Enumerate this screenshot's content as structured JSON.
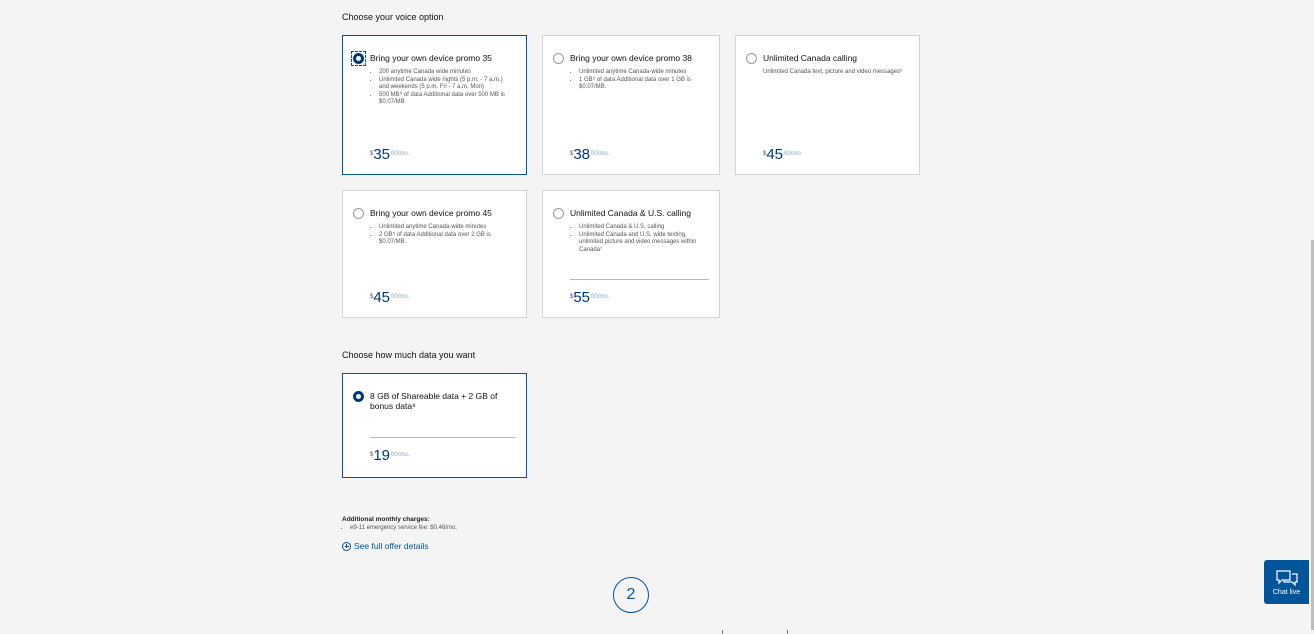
{
  "voice": {
    "title": "Choose your voice option",
    "options": [
      {
        "title": "Bring your own device promo 35",
        "features": [
          "200 anytime Canada wide minutes",
          "Unlimited Canada wide nights (5 p.m. - 7 a.m.) and weekends (5 p.m. Fri - 7 a.m. Mon)",
          "500 MB⁵ of data Additional data over 500 MB is $0.07/MB"
        ],
        "price": {
          "currency": "$",
          "dollars": "35",
          "cents": "00/mo."
        },
        "selected": true
      },
      {
        "title": "Bring your own device promo 38",
        "features": [
          "Unlimited anytime Canada-wide minutes",
          "1 GB⁵ of data Additional data over 1 GB is $0.07/MB."
        ],
        "price": {
          "currency": "$",
          "dollars": "38",
          "cents": "00/mo."
        },
        "selected": false
      },
      {
        "title": "Unlimited Canada calling",
        "description": "Unlimited Canada text, picture and video messages⁶",
        "price": {
          "currency": "$",
          "dollars": "45",
          "cents": "00/mo."
        },
        "selected": false
      },
      {
        "title": "Bring your own device promo 45",
        "features": [
          "Unlimited anytime Canada-wide minutes",
          "2 GB⁵ of data Additional data over 2 GB is $0.07/MB."
        ],
        "price": {
          "currency": "$",
          "dollars": "45",
          "cents": "00/mo."
        },
        "selected": false
      },
      {
        "title": "Unlimited Canada & U.S. calling",
        "features": [
          "Unlimited Canada & U.S. calling",
          "Unlimited Canada and U.S. wide texting, unlimited picture and video messages within Canada⁷"
        ],
        "price": {
          "currency": "$",
          "dollars": "55",
          "cents": "00/mo."
        },
        "selected": false
      }
    ]
  },
  "data_plan": {
    "title": "Choose how much data you want",
    "option": {
      "title": "8 GB of Shareable data + 2 GB of bonus data⁸",
      "price": {
        "currency": "$",
        "dollars": "19",
        "cents": "00/mo."
      },
      "selected": true
    }
  },
  "charges": {
    "title": "Additional monthly charges:",
    "items": [
      "e9-11 emergency service fee: $0.46/mo."
    ]
  },
  "offer_link": "See full offer details",
  "step_number": "2",
  "chat": {
    "label": "Chat live"
  },
  "colors": {
    "accent": "#00549a",
    "selected_border": "#00549a",
    "price": "#003778"
  }
}
